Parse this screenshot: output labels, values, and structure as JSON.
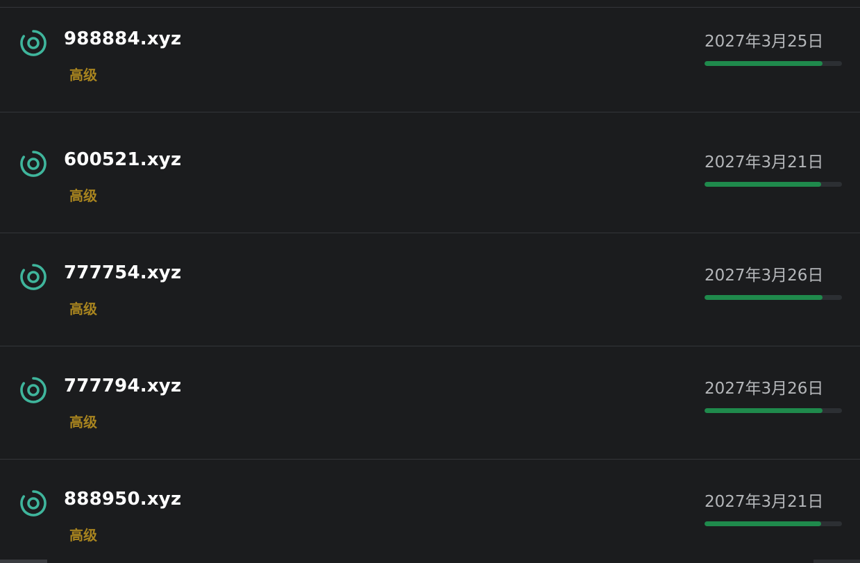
{
  "colors": {
    "background": "#1b1c1e",
    "divider": "#34363a",
    "icon": "#3fb59c",
    "domain_text": "#ffffff",
    "tier_text": "#a8841f",
    "date_text": "#b5b7ba",
    "progress_fill": "#1f8a4c",
    "progress_track": "#2c2f33"
  },
  "domains": [
    {
      "icon": "target-ring-icon",
      "name": "600521.xyz",
      "tier": "高级",
      "expiry": "2027年3月21日",
      "progress": 0.85
    },
    {
      "icon": "target-ring-icon",
      "name": "777754.xyz",
      "tier": "高级",
      "expiry": "2027年3月26日",
      "progress": 0.86
    },
    {
      "icon": "target-ring-icon",
      "name": "777794.xyz",
      "tier": "高级",
      "expiry": "2027年3月26日",
      "progress": 0.86
    },
    {
      "icon": "target-ring-icon",
      "name": "888950.xyz",
      "tier": "高级",
      "expiry": "2027年3月21日",
      "progress": 0.85
    },
    {
      "icon": "target-ring-icon",
      "name": "988884.xyz",
      "tier": "高级",
      "expiry": "2027年3月25日",
      "progress": 0.86
    }
  ]
}
